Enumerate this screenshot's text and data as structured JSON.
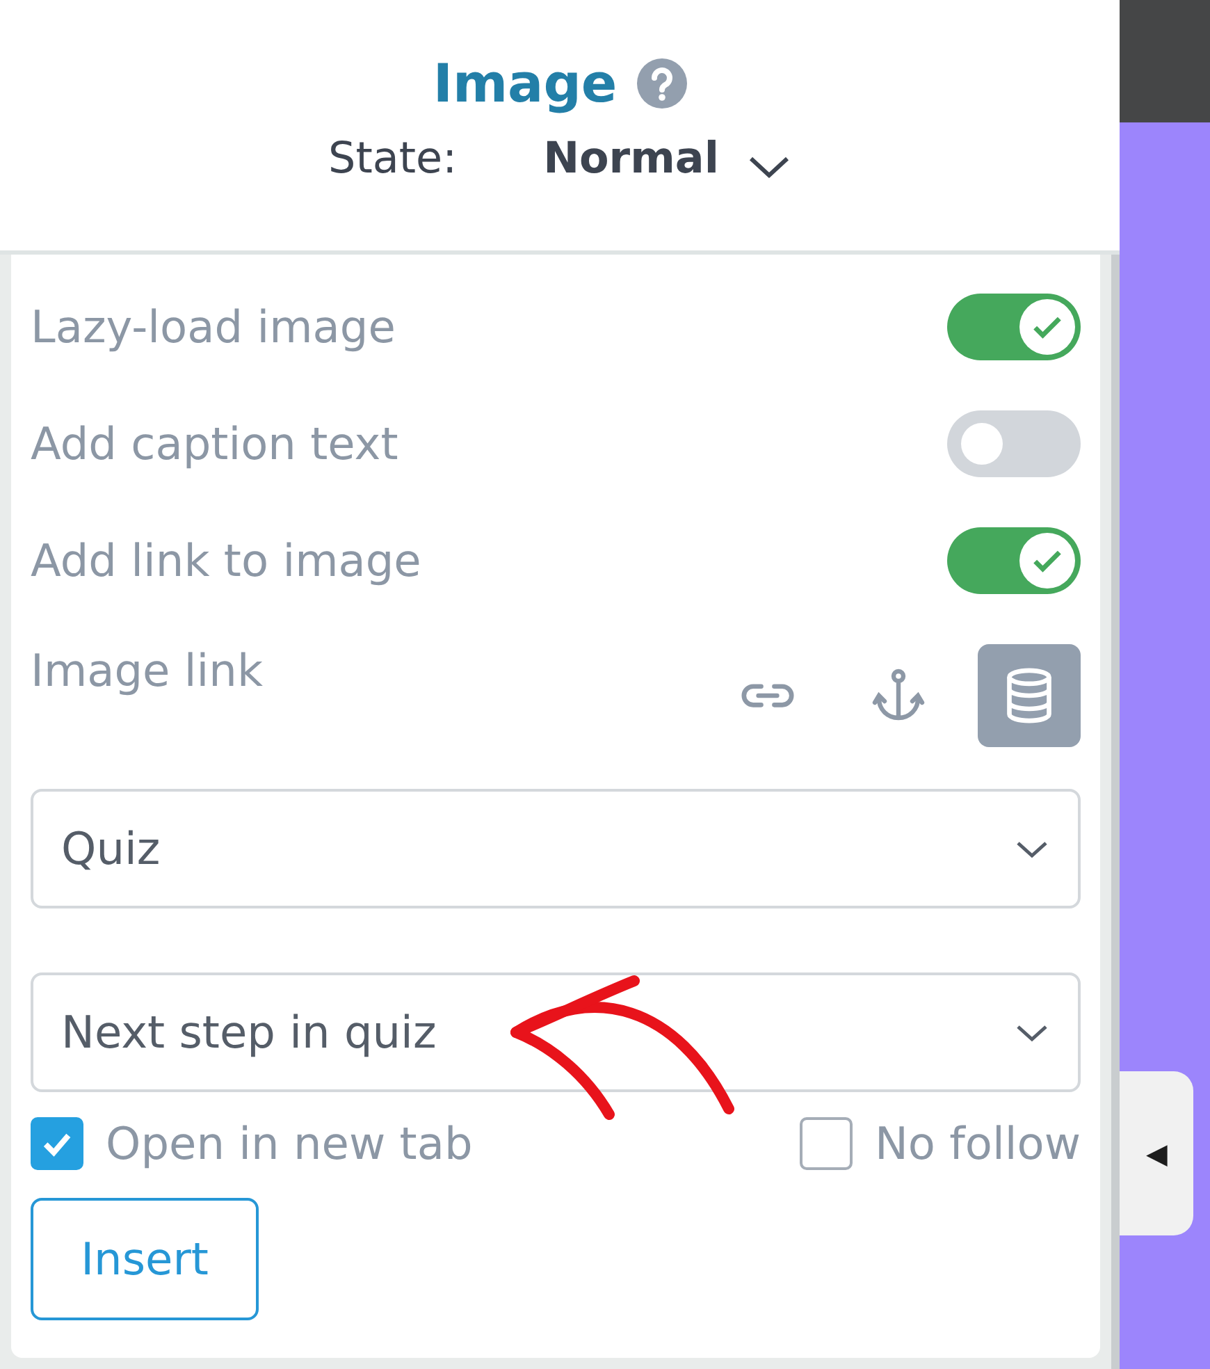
{
  "header": {
    "title": "Image",
    "state_label": "State:",
    "state_value": "Normal"
  },
  "toggles": [
    {
      "label": "Lazy-load image",
      "on": true
    },
    {
      "label": "Add caption text",
      "on": false
    },
    {
      "label": "Add link to image",
      "on": true
    }
  ],
  "image_link": {
    "label": "Image link",
    "link_types": [
      {
        "kind": "url",
        "selected": false
      },
      {
        "kind": "anchor",
        "selected": false
      },
      {
        "kind": "dynamic",
        "selected": true
      }
    ]
  },
  "selects": [
    {
      "value": "Quiz"
    },
    {
      "value": "Next step in quiz"
    }
  ],
  "checkboxes": [
    {
      "label": "Open in new tab",
      "checked": true
    },
    {
      "label": "No follow",
      "checked": false
    }
  ],
  "insert_button": "Insert",
  "collapse_tab": "◀"
}
